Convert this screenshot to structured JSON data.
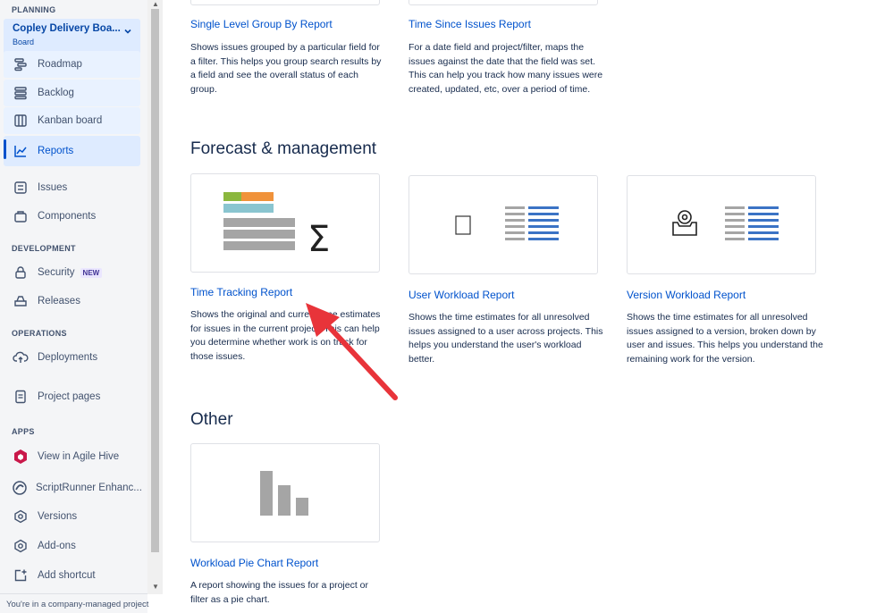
{
  "sidebar": {
    "planning_heading": "PLANNING",
    "board": {
      "name": "Copley Delivery Boa...",
      "type": "Board"
    },
    "planning_items": [
      {
        "label": "Roadmap",
        "icon": "roadmap-icon"
      },
      {
        "label": "Backlog",
        "icon": "backlog-icon"
      },
      {
        "label": "Kanban board",
        "icon": "kanban-board-icon"
      },
      {
        "label": "Reports",
        "icon": "reports-icon",
        "active": true
      }
    ],
    "issues_label": "Issues",
    "components_label": "Components",
    "development_heading": "DEVELOPMENT",
    "security_label": "Security",
    "security_badge": "NEW",
    "releases_label": "Releases",
    "operations_heading": "OPERATIONS",
    "deployments_label": "Deployments",
    "project_pages_label": "Project pages",
    "apps_heading": "APPS",
    "apps": [
      {
        "label": "View in Agile Hive",
        "icon": "agile-hive-icon"
      },
      {
        "label": "ScriptRunner Enhanc...",
        "icon": "scriptrunner-icon"
      },
      {
        "label": "Versions",
        "icon": "versions-icon"
      },
      {
        "label": "Add-ons",
        "icon": "add-ons-icon"
      },
      {
        "label": "Add shortcut",
        "icon": "add-shortcut-icon"
      }
    ],
    "footer": "You're in a company-managed project"
  },
  "main": {
    "top_reports": [
      {
        "title": "Single Level Group By Report",
        "description": "Shows issues grouped by a particular field for a filter. This helps you group search results by a field and see the overall status of each group."
      },
      {
        "title": "Time Since Issues Report",
        "description": "For a date field and project/filter, maps the issues against the date that the field was set. This can help you track how many issues were created, updated, etc, over a period of time."
      }
    ],
    "forecast_heading": "Forecast & management",
    "forecast_reports": [
      {
        "title": "Time Tracking Report",
        "description": "Shows the original and current time estimates for issues in the current project. This can help you determine whether work is on track for those issues."
      },
      {
        "title": "User Workload Report",
        "description": "Shows the time estimates for all unresolved issues assigned to a user across projects. This helps you understand the user's workload better."
      },
      {
        "title": "Version Workload Report",
        "description": "Shows the time estimates for all unresolved issues assigned to a version, broken down by user and issues. This helps you understand the remaining work for the version."
      }
    ],
    "other_heading": "Other",
    "other_reports": [
      {
        "title": "Workload Pie Chart Report",
        "description": "A report showing the issues for a project or filter as a pie chart."
      }
    ]
  },
  "colors": {
    "accent": "#0052CC",
    "arrow": "#E8343A",
    "sidebar_bg": "#F4F5F7"
  }
}
